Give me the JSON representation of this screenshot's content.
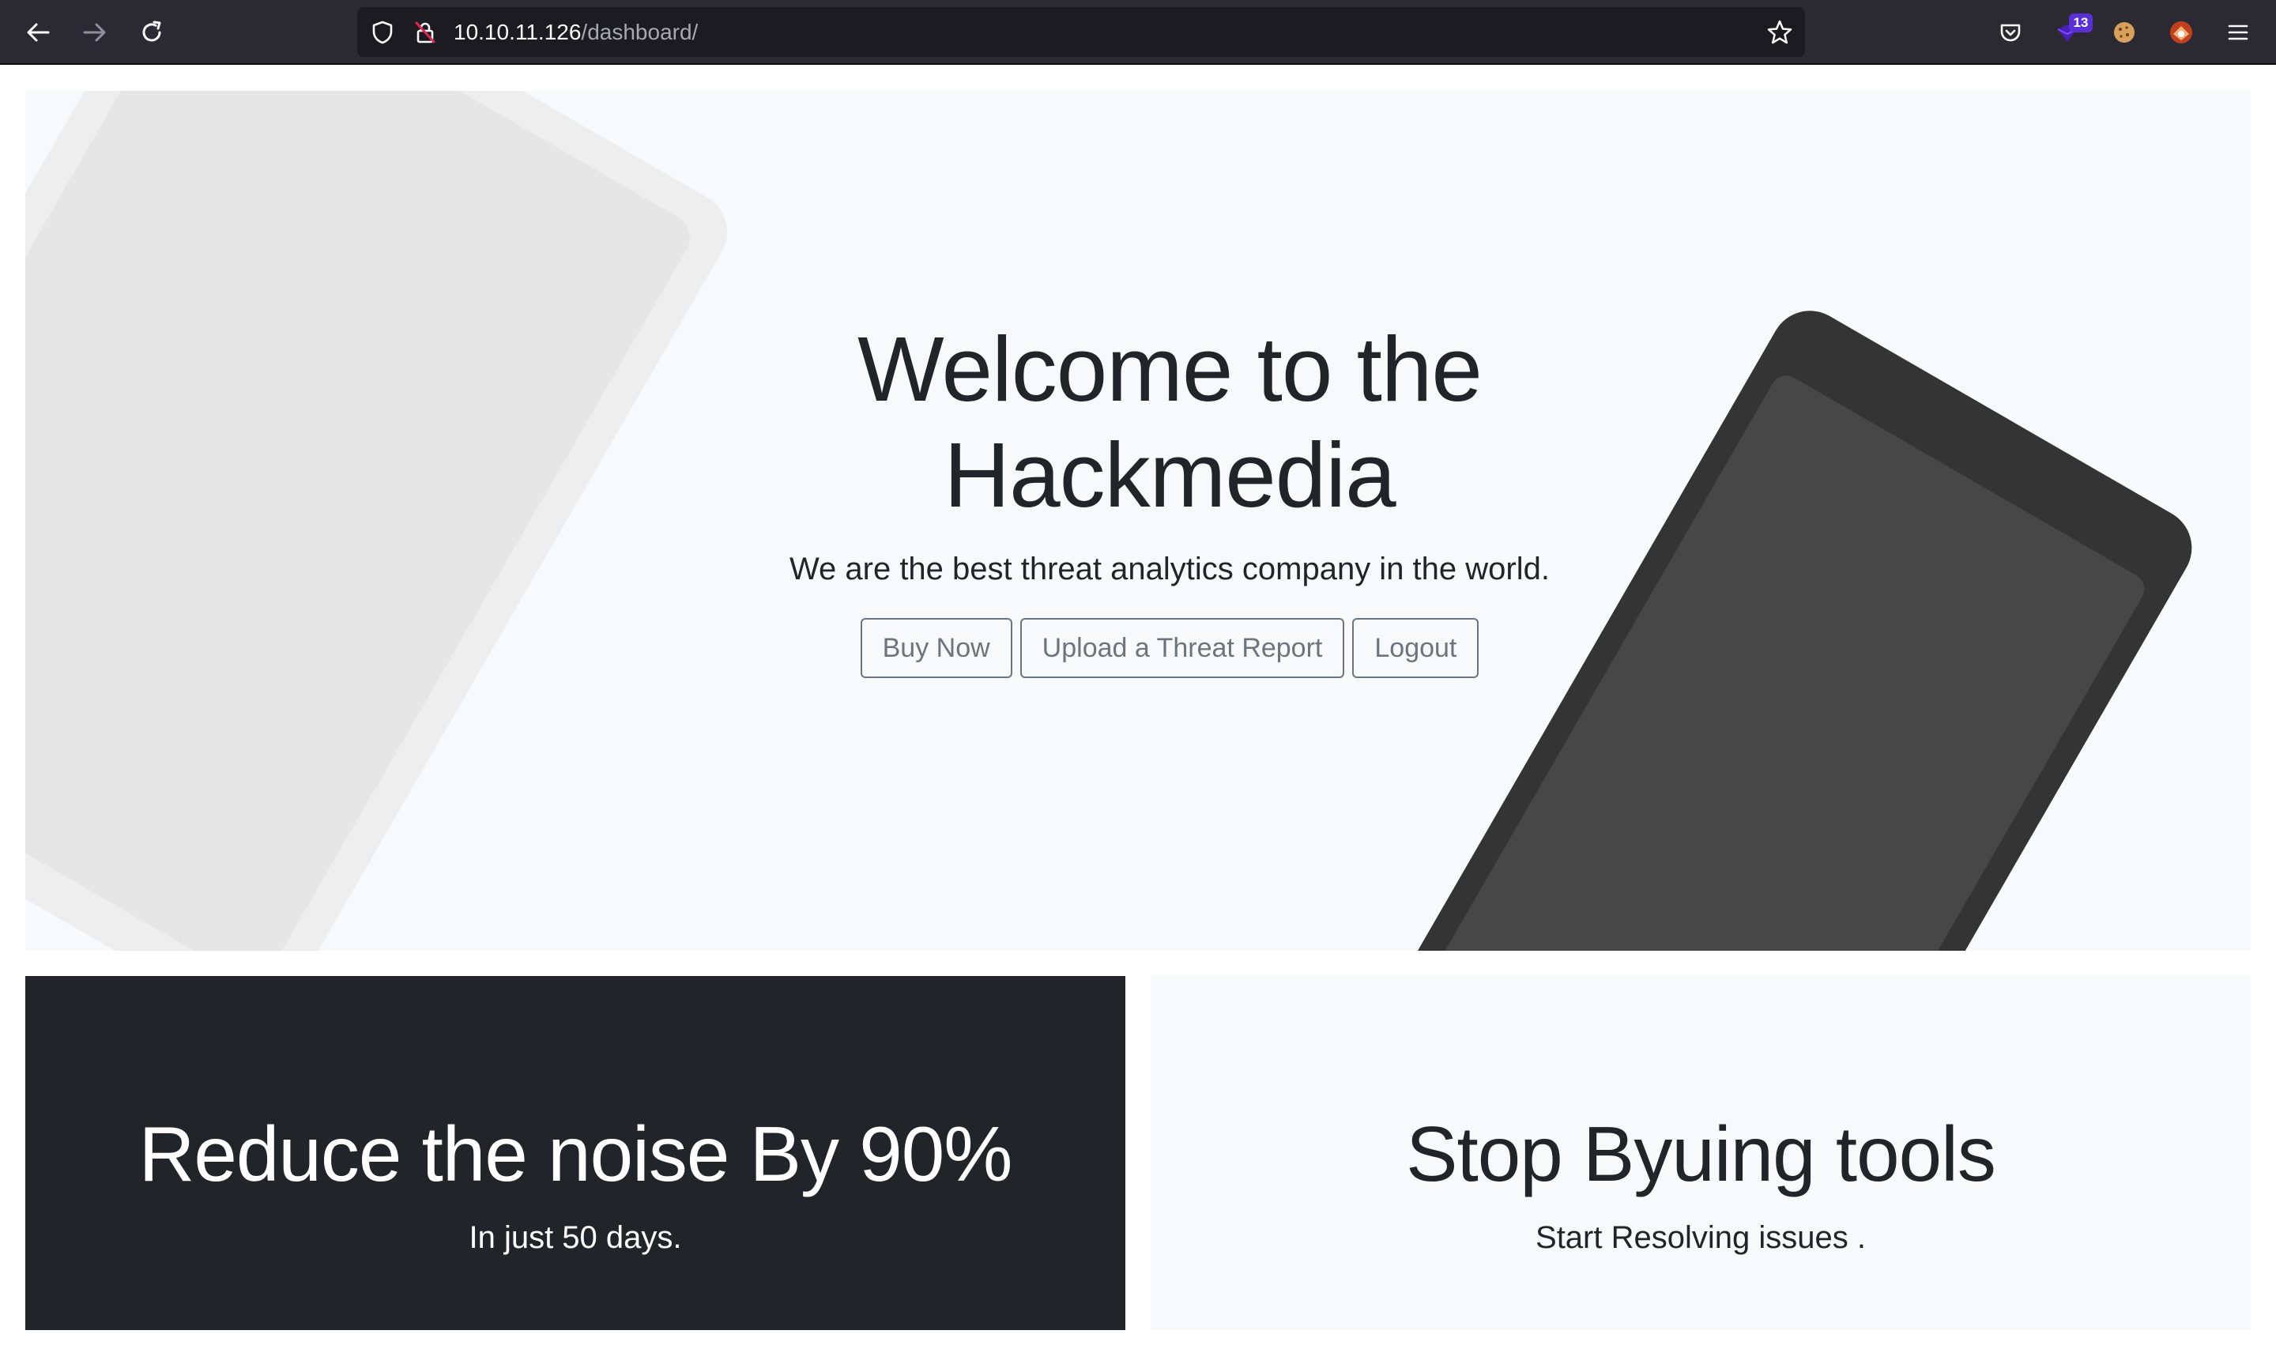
{
  "browser": {
    "url_host": "10.10.11.126",
    "url_path": "/dashboard/",
    "extension_badge": "13",
    "icons": [
      "back-arrow-icon",
      "forward-arrow-icon",
      "reload-icon",
      "shield-icon",
      "insecure-lock-icon",
      "star-icon",
      "pocket-icon",
      "extension-icon",
      "cookie-icon",
      "fox-extension-icon",
      "menu-icon"
    ]
  },
  "hero": {
    "title_line1": "Welcome to the",
    "title_line2": "Hackmedia",
    "lead": "We are the best threat analytics company in the world.",
    "buttons": {
      "buy": "Buy Now",
      "upload": "Upload a Threat Report",
      "logout": "Logout"
    }
  },
  "panels": {
    "left": {
      "title": "Reduce the noise By 90%",
      "subtitle": "In just 50 days."
    },
    "right": {
      "title": "Stop Byuing tools",
      "subtitle": "Start Resolving issues ."
    }
  },
  "colors": {
    "chrome_bg": "#2b2a33",
    "urlbar_bg": "#1c1b22",
    "hero_bg": "#f8f9fa",
    "dark_panel": "#212529",
    "button_outline": "#6c757d"
  }
}
